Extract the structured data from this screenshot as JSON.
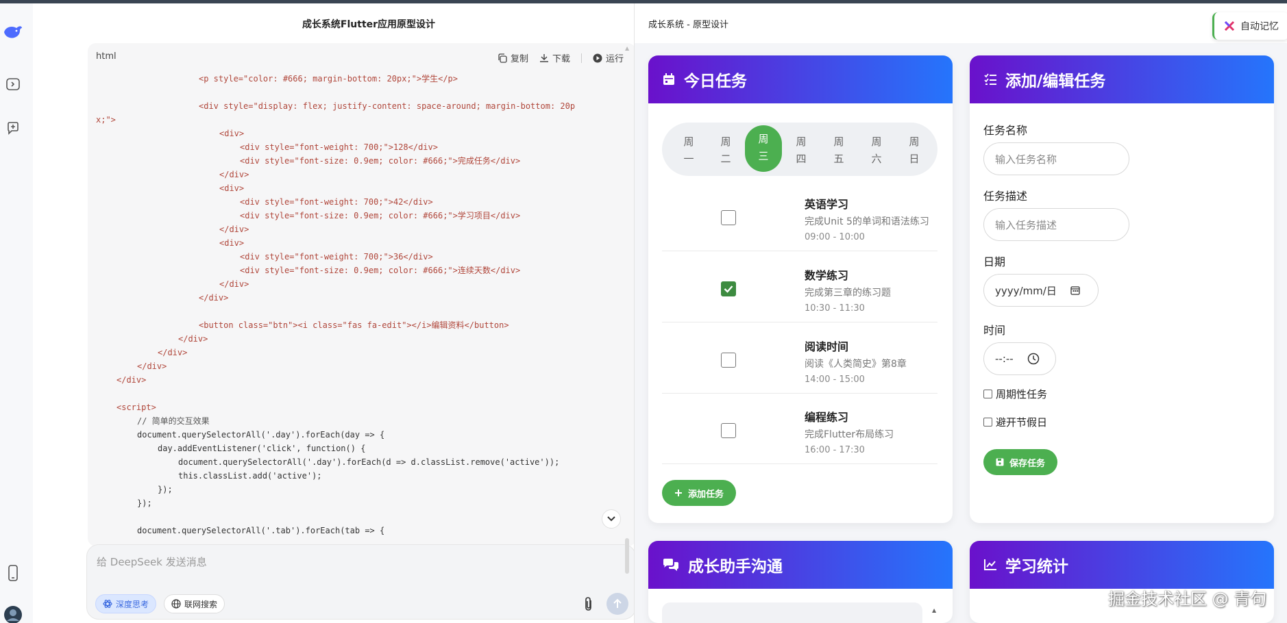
{
  "chat": {
    "title": "成长系统Flutter应用原型设计",
    "code_lang": "html",
    "copy_label": "复制",
    "download_label": "下载",
    "run_label": "运行",
    "input_placeholder": "给 DeepSeek 发送消息",
    "deep_think_label": "深度思考",
    "web_search_label": "联网搜索"
  },
  "code_lines": [
    "<p style=\"color: #666; margin-bottom: 20px;\">学生</p>",
    "",
    "<div style=\"display: flex; justify-content: space-around; margin-bottom: 20p",
    "x;\">",
    "<div>",
    "<div style=\"font-weight: 700;\">128</div>",
    "<div style=\"font-size: 0.9em; color: #666;\">完成任务</div>",
    "</div>",
    "<div>",
    "<div style=\"font-weight: 700;\">42</div>",
    "<div style=\"font-size: 0.9em; color: #666;\">学习项目</div>",
    "</div>",
    "<div>",
    "<div style=\"font-weight: 700;\">36</div>",
    "<div style=\"font-size: 0.9em; color: #666;\">连续天数</div>",
    "</div>",
    "</div>",
    "",
    "<button class=\"btn\"><i class=\"fas fa-edit\"></i>编辑资料</button>",
    "</div>",
    "</div>",
    "</div>",
    "</div>",
    "",
    "<script>",
    "// 简单的交互效果",
    "document.querySelectorAll('.day').forEach(day => {",
    "day.addEventListener('click', function() {",
    "document.querySelectorAll('.day').forEach(d => d.classList.remove('active'));",
    "this.classList.add('active');",
    "});",
    "});",
    "",
    "document.querySelectorAll('.tab').forEach(tab => {"
  ],
  "preview": {
    "title": "成长系统 - 原型设计",
    "memory_label": "自动记忆",
    "today": {
      "title": "今日任务",
      "days": [
        "周一",
        "周二",
        "周三",
        "周四",
        "周五",
        "周六",
        "周日"
      ],
      "active_day": "周三",
      "tasks": [
        {
          "name": "英语学习",
          "desc": "完成Unit 5的单词和语法练习",
          "time": "09:00 - 10:00",
          "done": false
        },
        {
          "name": "数学练习",
          "desc": "完成第三章的练习题",
          "time": "10:30 - 11:30",
          "done": true
        },
        {
          "name": "阅读时间",
          "desc": "阅读《人类简史》第8章",
          "time": "14:00 - 15:00",
          "done": false
        },
        {
          "name": "编程练习",
          "desc": "完成Flutter布局练习",
          "time": "16:00 - 17:30",
          "done": false
        }
      ],
      "add_label": "添加任务"
    },
    "edit": {
      "title": "添加/编辑任务",
      "name_label": "任务名称",
      "name_placeholder": "输入任务名称",
      "desc_label": "任务描述",
      "desc_placeholder": "输入任务描述",
      "date_label": "日期",
      "date_placeholder": "yyyy/mm/日",
      "time_label": "时间",
      "time_placeholder": "--:--",
      "periodic_label": "周期性任务",
      "holiday_label": "避开节假日",
      "save_label": "保存任务"
    },
    "assistant": {
      "title": "成长助手沟通"
    },
    "stats": {
      "title": "学习统计"
    }
  },
  "watermark": "掘金技术社区 @ 青句",
  "colors": {
    "accent_green": "#4caf50",
    "gradient_start": "#6a11cb",
    "gradient_end": "#2575fc"
  }
}
